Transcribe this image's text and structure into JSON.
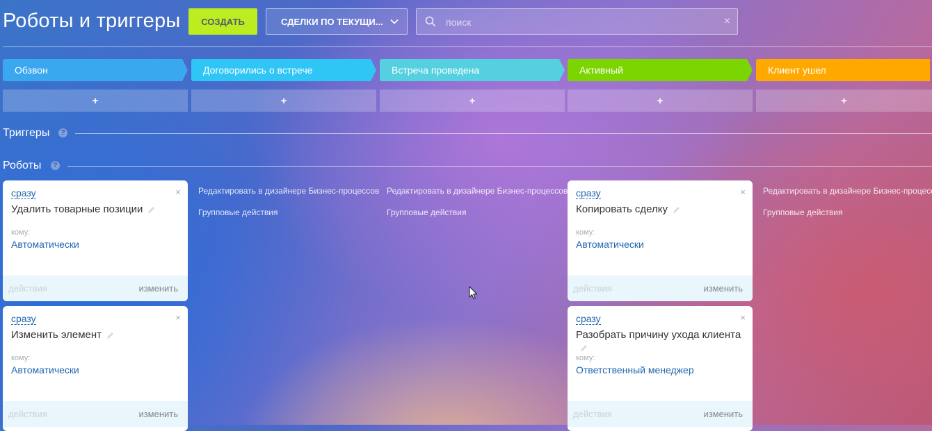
{
  "header": {
    "title": "Роботы и триггеры",
    "create_label": "СОЗДАТЬ",
    "filter_label": "СДЕЛКИ ПО ТЕКУЩИ...",
    "search_placeholder": "поиск"
  },
  "stages": [
    {
      "label": "Обзвон",
      "color": "#39a8ef"
    },
    {
      "label": "Договорились о встрече",
      "color": "#2fc6f6"
    },
    {
      "label": "Встреча проведена",
      "color": "#55d0e0"
    },
    {
      "label": "Активный",
      "color": "#7bd500"
    },
    {
      "label": "Клиент ушел",
      "color": "#ffa900"
    }
  ],
  "add_symbol": "+",
  "sections": {
    "triggers": "Триггеры",
    "robots": "Роботы",
    "help": "?"
  },
  "column_links": {
    "designer": "Редактировать в дизайнере Бизнес-процессов",
    "group": "Групповые действия"
  },
  "robots": {
    "col1": [
      {
        "when": "сразу",
        "name": "Удалить товарные позиции",
        "to_label": "кому:",
        "to_value": "Автоматически",
        "actions": "действия",
        "edit": "изменить"
      },
      {
        "when": "сразу",
        "name": "Изменить элемент",
        "to_label": "кому:",
        "to_value": "Автоматически",
        "actions": "действия",
        "edit": "изменить"
      }
    ],
    "col4": [
      {
        "when": "сразу",
        "name": "Копировать сделку",
        "to_label": "кому:",
        "to_value": "Автоматически",
        "actions": "действия",
        "edit": "изменить"
      },
      {
        "when": "сразу",
        "name": "Разобрать причину ухода клиента",
        "to_label": "кому:",
        "to_value": "Ответственный менеджер",
        "actions": "действия",
        "edit": "изменить"
      }
    ]
  },
  "close_symbol": "×",
  "clear_symbol": "×"
}
